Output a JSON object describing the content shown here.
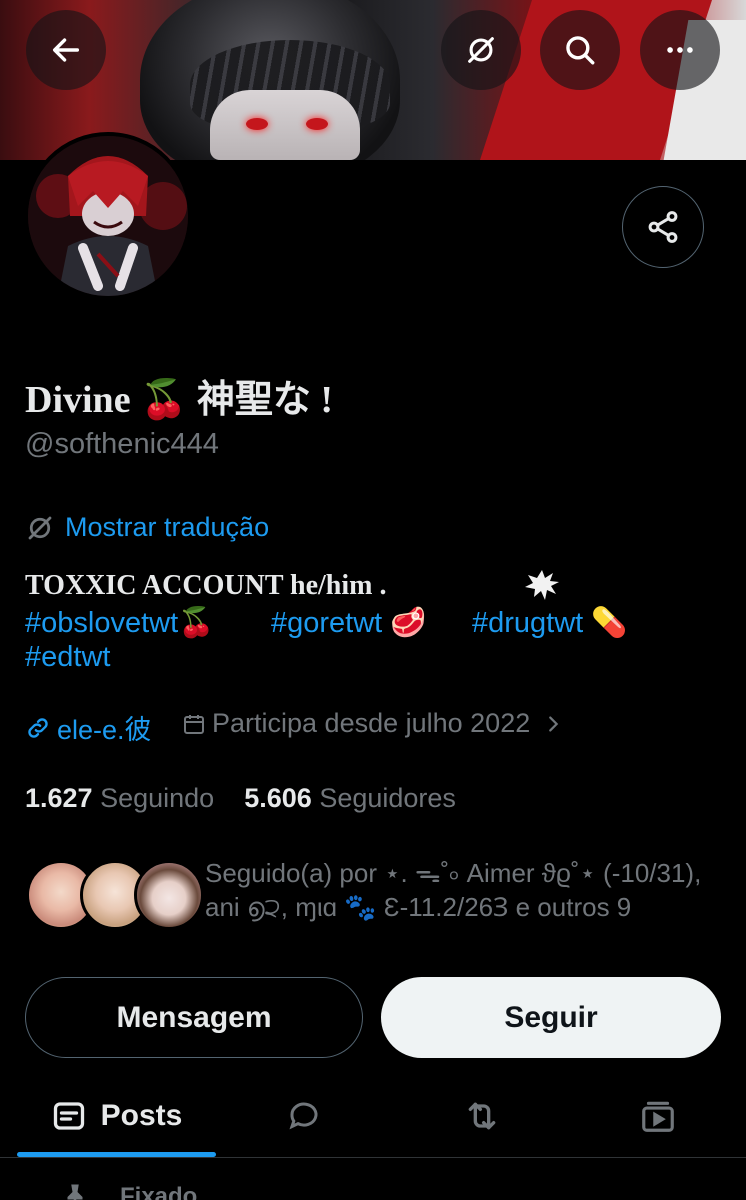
{
  "profile": {
    "display_name": "Divine 🍒 神聖な !",
    "handle": "@softhenic444",
    "translate_label": "Mostrar tradução",
    "bio_line1": "TOXXIC ACCOUNT he/him .",
    "hashtags": [
      {
        "tag": "#obslovetwt",
        "emoji": "🍒"
      },
      {
        "tag": "#goretwt",
        "emoji": "🥩"
      },
      {
        "tag": "#drugtwt",
        "emoji": "💊"
      },
      {
        "tag": "#edtwt",
        "emoji": ""
      }
    ],
    "link_text": "ele-e.彼",
    "joined_text": "Participa desde julho 2022",
    "following_count": "1.627",
    "following_label": "Seguindo",
    "followers_count": "5.606",
    "followers_label": "Seguidores",
    "followed_by_text": "Seguido(a) por ⋆. ᯓ˚৹ Aimer ϑϱ˚⋆ (-10/31), ani ൭੨, ɱιɑ 🐾 Ɛ-11.2/26Ɜ e outros 9"
  },
  "header": {
    "back_icon": "arrow-left-icon",
    "translate_icon": "translate-off-icon",
    "search_icon": "search-icon",
    "more_icon": "more-horizontal-icon",
    "share_icon": "share-icon"
  },
  "actions": {
    "message_label": "Mensagem",
    "follow_label": "Seguir"
  },
  "tabs": [
    {
      "label": "Posts",
      "icon": "posts-icon",
      "active": true
    },
    {
      "label": "",
      "icon": "replies-icon",
      "active": false
    },
    {
      "label": "",
      "icon": "repost-icon",
      "active": false
    },
    {
      "label": "",
      "icon": "media-icon",
      "active": false
    }
  ],
  "pinned_label": "Fixado",
  "colors": {
    "background": "#000000",
    "accent": "#1d9bf0",
    "text_primary": "#e7e9ea",
    "text_secondary": "#71767b",
    "follow_button_bg": "#eff3f4"
  }
}
